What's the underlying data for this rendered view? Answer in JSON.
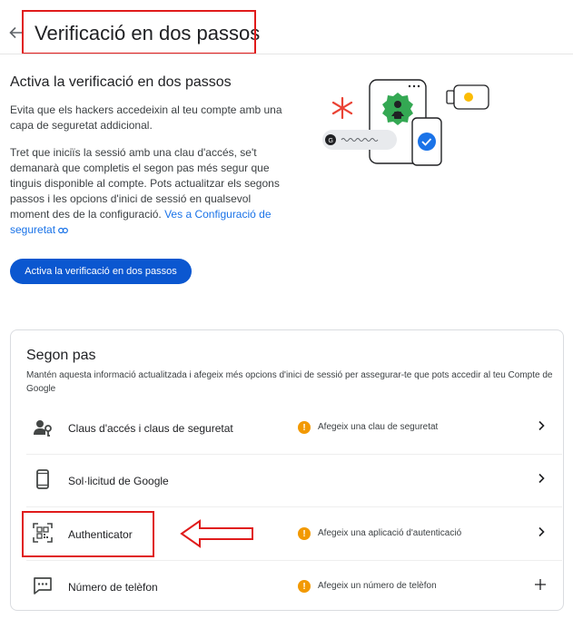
{
  "header": {
    "title": "Verificació en dos passos",
    "back_icon": "arrow-left-icon"
  },
  "intro": {
    "title": "Activa la verificació en dos passos",
    "paragraph1": "Evita que els hackers accedeixin al teu compte amb una capa de seguretat addicional.",
    "paragraph2_text": "Tret que iniciïs la sessió amb una clau d'accés, se't demanarà que completis el segon pas més segur que tinguis disponible al compte. Pots actualitzar els segons passos i les opcions d'inici de sessió en qualsevol moment des de la configuració. ",
    "paragraph2_link": "Ves a Configuració de seguretat",
    "button_label": "Activa la verificació en dos passos"
  },
  "second_step": {
    "title": "Segon pas",
    "description": "Mantén aquesta informació actualitzada i afegeix més opcions d'inici de sessió per assegurar-te que pots accedir al teu Compte de Google",
    "items": [
      {
        "label": "Claus d'accés i claus de seguretat",
        "icon": "person-key-icon",
        "status": "Afegeix una clau de seguretat",
        "action_icon": "chevron-right-icon"
      },
      {
        "label": "Sol·licitud de Google",
        "icon": "phone-icon",
        "status": "",
        "action_icon": "chevron-right-icon"
      },
      {
        "label": "Authenticator",
        "icon": "qr-code-icon",
        "status": "Afegeix una aplicació d'autenticació",
        "action_icon": "chevron-right-icon"
      },
      {
        "label": "Número de telèfon",
        "icon": "message-icon",
        "status": "Afegeix un número de telèfon",
        "action_icon": "plus-icon"
      }
    ]
  },
  "annotation_colors": {
    "highlight": "#e01b1b",
    "primary": "#0b57d0",
    "warning": "#f29900"
  }
}
